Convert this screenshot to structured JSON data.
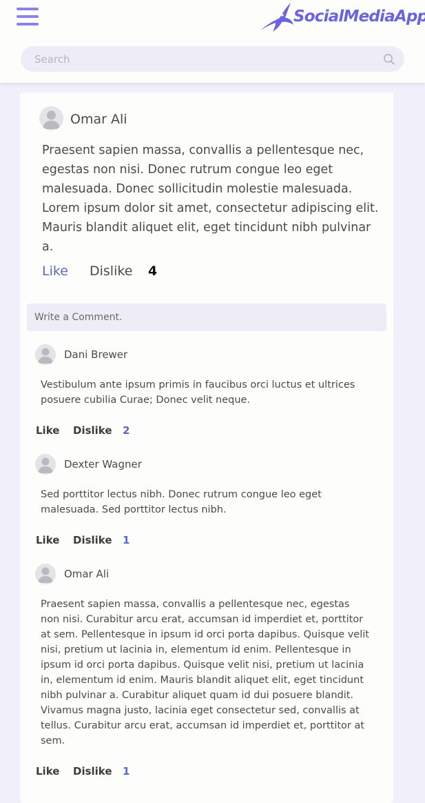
{
  "header": {
    "menu_icon": "hamburger-menu-icon",
    "logo_text": "SocialMediaApp",
    "logo_icon": "swallow-bird-icon",
    "search": {
      "placeholder": "Search",
      "icon": "search-icon"
    }
  },
  "post": {
    "author": "Omar Ali",
    "avatar_icon": "default-avatar-icon",
    "text": "Praesent sapien massa, convallis a pellentesque nec, egestas non nisi. Donec rutrum congue leo eget malesuada. Donec sollicitudin molestie malesuada. Lorem ipsum dolor sit amet, consectetur adipiscing elit. Mauris blandit aliquet elit, eget tincidunt nibh pulvinar a.",
    "like_label": "Like",
    "dislike_label": "Dislike",
    "count": "4"
  },
  "comment_input": {
    "placeholder": "Write a Comment."
  },
  "comments": [
    {
      "author": "Dani Brewer",
      "text": "Vestibulum ante ipsum primis in faucibus orci luctus et ultrices posuere cubilia Curae; Donec velit neque.",
      "like_label": "Like",
      "dislike_label": "Dislike",
      "count": "2"
    },
    {
      "author": "Dexter Wagner",
      "text": "Sed porttitor lectus nibh. Donec rutrum congue leo eget malesuada. Sed porttitor lectus nibh.",
      "like_label": "Like",
      "dislike_label": "Dislike",
      "count": "1"
    },
    {
      "author": "Omar Ali",
      "text": "Praesent sapien massa, convallis a pellentesque nec, egestas non nisi. Curabitur arcu erat, accumsan id imperdiet et, porttitor at sem. Pellentesque in ipsum id orci porta dapibus. Quisque velit nisi, pretium ut lacinia in, elementum id enim. Pellentesque in ipsum id orci porta dapibus. Quisque velit nisi, pretium ut lacinia in, elementum id enim. Mauris blandit aliquet elit, eget tincidunt nibh pulvinar a. Curabitur aliquet quam id dui posuere blandit. Vivamus magna justo, lacinia eget consectetur sed, convallis at tellus. Curabitur arcu erat, accumsan id imperdiet et, porttitor at sem.",
      "like_label": "Like",
      "dislike_label": "Dislike",
      "count": "1"
    }
  ],
  "colors": {
    "accent": "#6b63e0",
    "menu": "#8a83e8",
    "link_blue": "#5b66c9",
    "page_bg": "#f0effa",
    "card_bg": "#fdfdfb",
    "input_bg": "#eeedf7"
  }
}
